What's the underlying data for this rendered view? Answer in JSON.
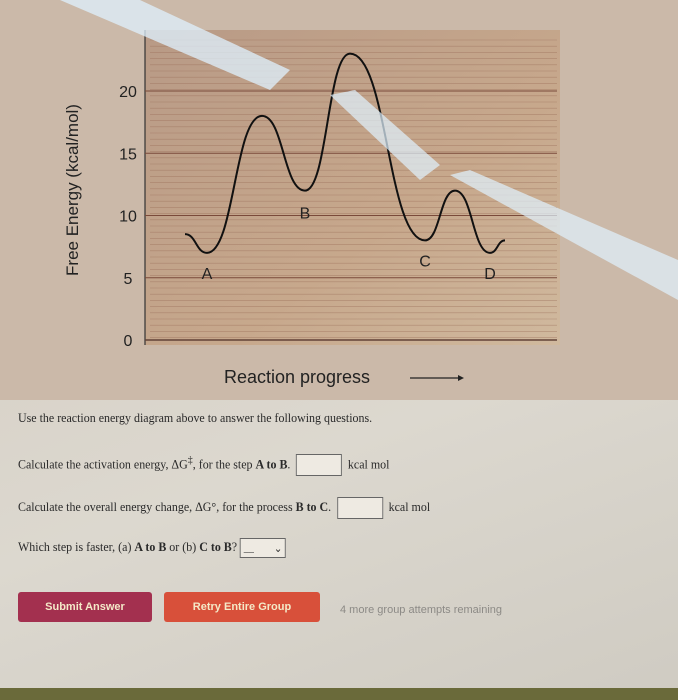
{
  "chart_data": {
    "type": "line",
    "title": "",
    "xlabel": "Reaction progress",
    "ylabel": "Free Energy (kcal/mol)",
    "ylim": [
      0,
      24
    ],
    "yticks": [
      0,
      5,
      10,
      15,
      20
    ],
    "grid": true,
    "stationary_points": [
      {
        "label": "",
        "energy": 8.5
      },
      {
        "label": "A",
        "energy": 7
      },
      {
        "label": "",
        "energy": 18
      },
      {
        "label": "B",
        "energy": 12
      },
      {
        "label": "",
        "energy": 23
      },
      {
        "label": "C",
        "energy": 8
      },
      {
        "label": "",
        "energy": 12
      },
      {
        "label": "D",
        "energy": 7
      },
      {
        "label": "",
        "energy": 8
      }
    ],
    "line_color": "#111111"
  },
  "questions": {
    "intro": "Use the reaction energy diagram above to answer the following questions.",
    "q1": {
      "pre": "Calculate the activation energy, ΔG",
      "sup": "‡",
      "mid": ", for the step ",
      "bold": "A to B",
      "post": ".",
      "value": "",
      "unit": "kcal mol"
    },
    "q2": {
      "pre": "Calculate the overall energy change, ΔG°, for the process ",
      "bold": "B to C",
      "post": ".",
      "value": "",
      "unit": "kcal mol"
    },
    "q3": {
      "pre": "Which step is faster, (a) ",
      "bold1": "A to B",
      "mid": " or (b) ",
      "bold2": "C to B",
      "post": "?",
      "selected": "__"
    }
  },
  "buttons": {
    "submit": "Submit Answer",
    "retry": "Retry Entire Group"
  },
  "attempts": "4 more group attempts remaining",
  "colors": {
    "submit": "#a3304f",
    "retry": "#d8503a"
  }
}
